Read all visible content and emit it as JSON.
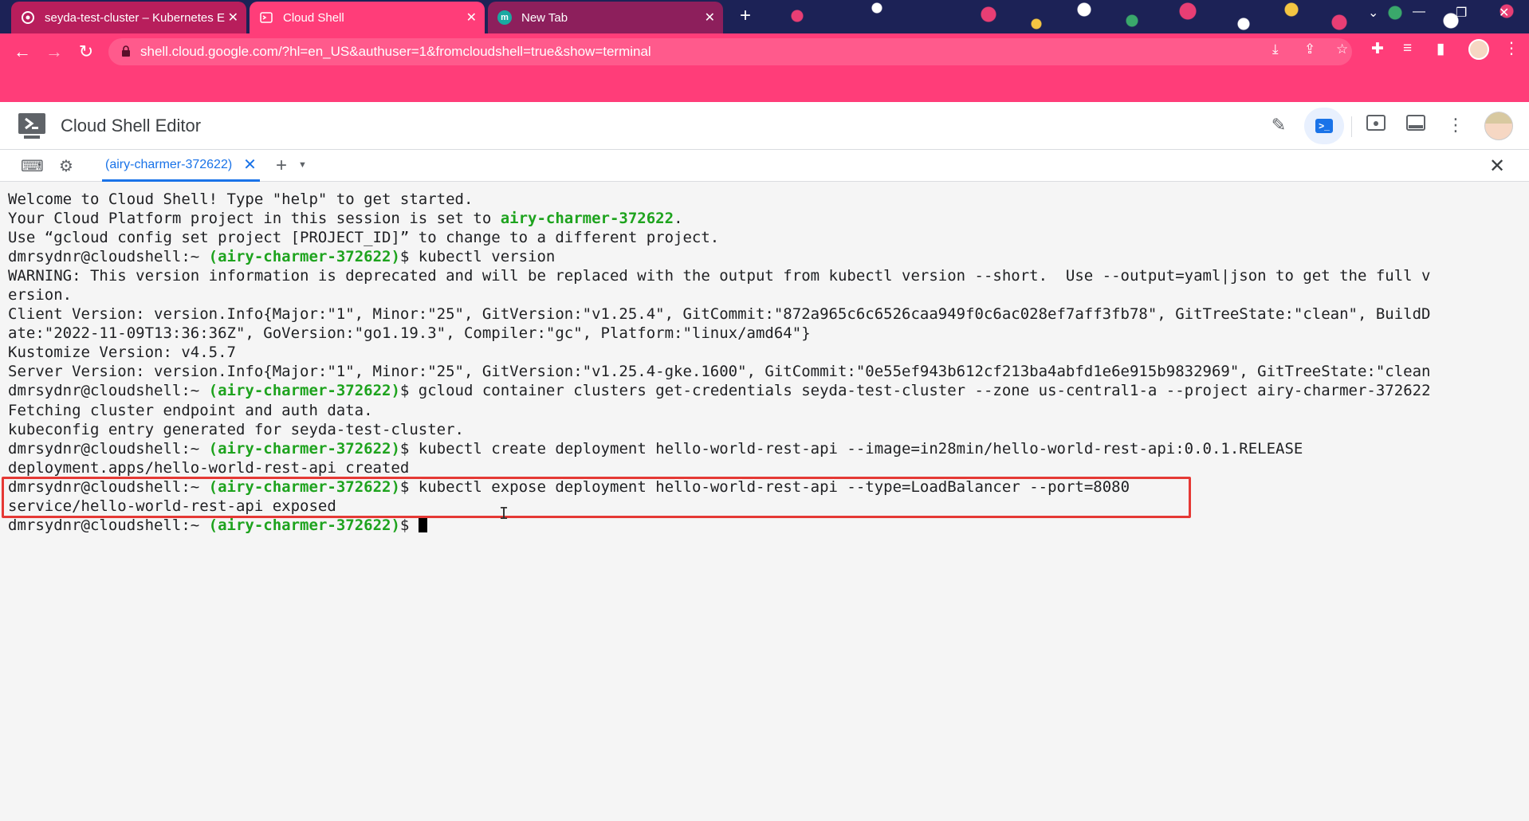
{
  "browser": {
    "tabs": [
      {
        "title": "seyda-test-cluster – Kubernetes E",
        "close": "✕"
      },
      {
        "title": "Cloud Shell",
        "close": "✕"
      },
      {
        "title": "New Tab",
        "close": "✕",
        "favicon_letter": "m"
      }
    ],
    "new_tab": "+",
    "url": "shell.cloud.google.com/?hl=en_US&authuser=1&fromcloudshell=true&show=terminal",
    "colors": {
      "toolbar": "#ff3d79",
      "active_tab": "#ff3d79"
    }
  },
  "header": {
    "title": "Cloud Shell Editor"
  },
  "terminal_tabs": {
    "active_tab": "(airy-charmer-372622)",
    "close": "✕",
    "add": "+"
  },
  "terminal": {
    "prompt_user": "dmrsydnr@cloudshell:~ ",
    "project": "(airy-charmer-372622)",
    "prompt_end": "$ ",
    "lines": {
      "l1": "Welcome to Cloud Shell! Type \"help\" to get started.",
      "l2a": "Your Cloud Platform project in this session is set to ",
      "l2b": "airy-charmer-372622",
      "l2c": ".",
      "l3": "Use “gcloud config set project [PROJECT_ID]” to change to a different project.",
      "cmd1": "kubectl version",
      "l5": "WARNING: This version information is deprecated and will be replaced with the output from kubectl version --short.  Use --output=yaml|json to get the full v",
      "l6": "ersion.",
      "l7": "Client Version: version.Info{Major:\"1\", Minor:\"25\", GitVersion:\"v1.25.4\", GitCommit:\"872a965c6c6526caa949f0c6ac028ef7aff3fb78\", GitTreeState:\"clean\", BuildD",
      "l8": "ate:\"2022-11-09T13:36:36Z\", GoVersion:\"go1.19.3\", Compiler:\"gc\", Platform:\"linux/amd64\"}",
      "l9": "Kustomize Version: v4.5.7",
      "l10": "Server Version: version.Info{Major:\"1\", Minor:\"25\", GitVersion:\"v1.25.4-gke.1600\", GitCommit:\"0e55ef943b612cf213ba4abfd1e6e915b9832969\", GitTreeState:\"clean",
      "cmd2": "gcloud container clusters get-credentials seyda-test-cluster --zone us-central1-a --project airy-charmer-372622",
      "l12": "Fetching cluster endpoint and auth data.",
      "l13": "kubeconfig entry generated for seyda-test-cluster.",
      "cmd3": "kubectl create deployment hello-world-rest-api --image=in28min/hello-world-rest-api:0.0.1.RELEASE",
      "l15": "deployment.apps/hello-world-rest-api created",
      "cmd4": "kubectl expose deployment hello-world-rest-api --type=LoadBalancer --port=8080",
      "l17": "service/hello-world-rest-api exposed"
    },
    "colors": {
      "project": "#1ea31e",
      "highlight_border": "#e53935"
    }
  }
}
